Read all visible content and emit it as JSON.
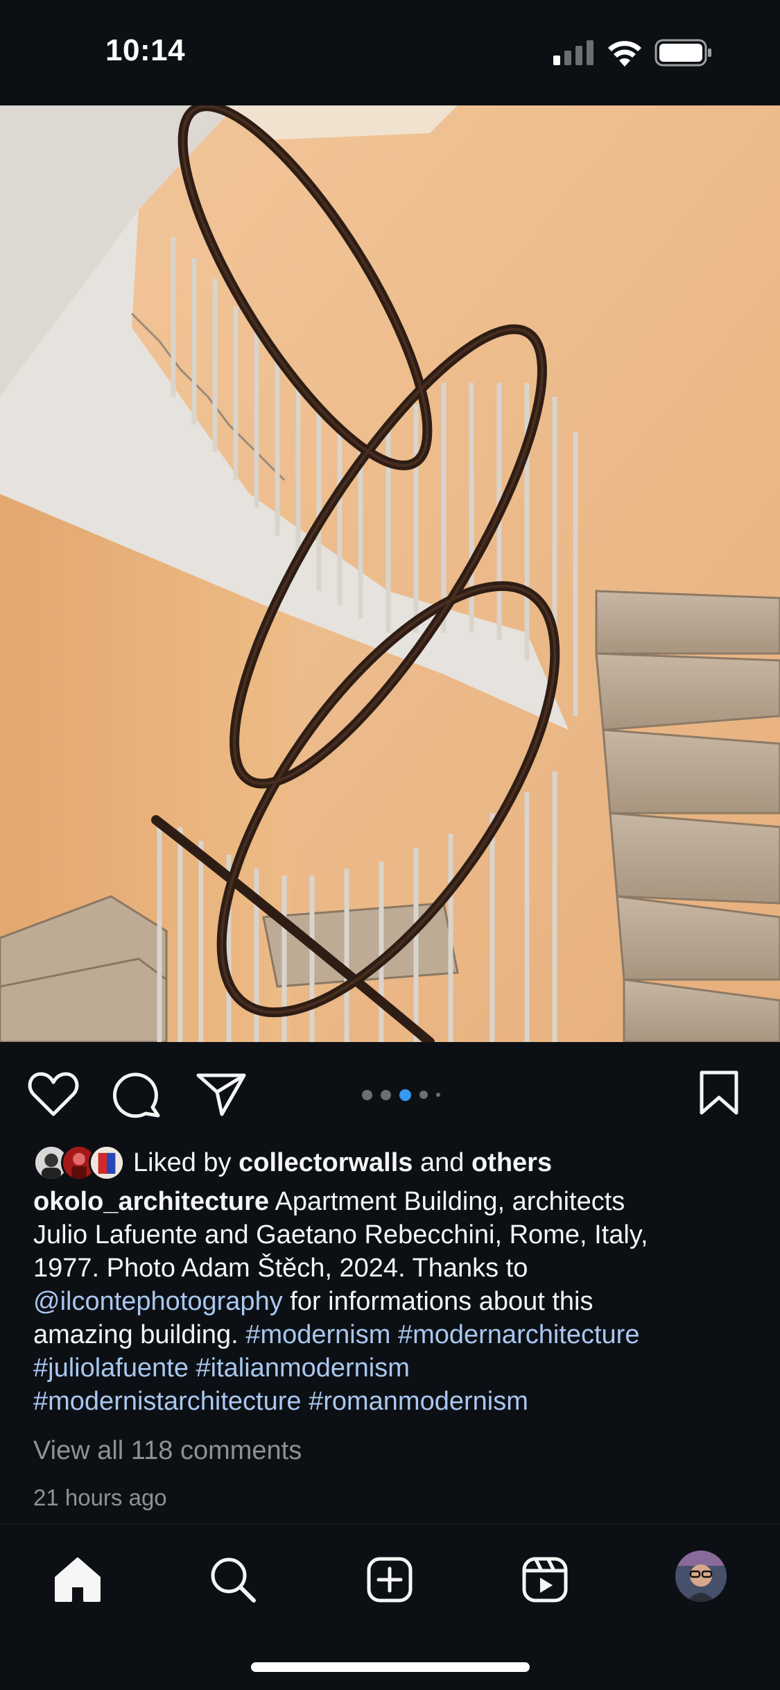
{
  "status_bar": {
    "time": "10:14"
  },
  "post": {
    "carousel": {
      "count": 5,
      "active_index": 2
    },
    "likes": {
      "prefix": "Liked by",
      "user": "collectorwalls",
      "connector": "and",
      "others": "others"
    },
    "caption": {
      "author": "okolo_architecture",
      "line1": "Apartment Building, architects",
      "line2": "Julio Lafuente and Gaetano Rebecchini, Rome, Italy,",
      "line3": "1977. Photo Adam Štěch, 2024. Thanks to",
      "mention": "@ilcontephotography",
      "line4_rest": "for informations about this",
      "line5_text": "amazing building.",
      "tag1": "#modernism",
      "tag2": "#modernarchitecture",
      "tag3": "#juliolafuente",
      "tag4": "#italianmodernism",
      "tag5": "#modernistarchitecture",
      "tag6": "#romanmodernism"
    },
    "view_comments": "View all 118 comments",
    "timestamp": "21 hours ago"
  },
  "colors": {
    "background": "#0c1014",
    "link": "#a9c7f0",
    "active_dot": "#3897f0",
    "muted_text": "#8e9296"
  },
  "icons": {
    "like": "heart-icon",
    "comment": "speech-bubble-icon",
    "share": "paper-plane-icon",
    "save": "bookmark-icon",
    "nav": [
      "home-icon",
      "search-icon",
      "create-icon",
      "reels-icon",
      "profile-avatar"
    ]
  }
}
